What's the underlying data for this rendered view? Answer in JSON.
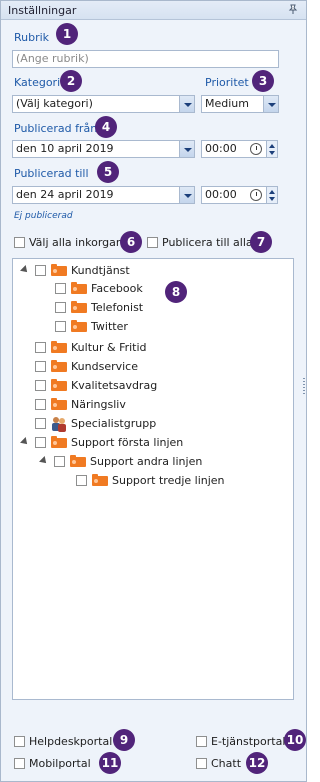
{
  "panel": {
    "title": "Inställningar"
  },
  "rubrik": {
    "label": "Rubrik",
    "placeholder": "(Ange rubrik)",
    "badge": "1"
  },
  "kategori": {
    "label": "Kategori",
    "value": "(Välj kategori)",
    "badge": "2"
  },
  "prioritet": {
    "label": "Prioritet",
    "value": "Medium",
    "badge": "3"
  },
  "publicerad_fran": {
    "label": "Publicerad från",
    "date": "den 10 april 2019",
    "time": "00:00",
    "badge": "4"
  },
  "publicerad_till": {
    "label": "Publicerad till",
    "date": "den 24 april 2019",
    "time": "00:00",
    "badge": "5"
  },
  "status_hint": "Ej publicerad",
  "select_all_inboxes": {
    "label": "Välj alla inkorgar",
    "badge": "6"
  },
  "publish_to_all": {
    "label": "Publicera till alla",
    "badge": "7"
  },
  "tree": {
    "badge": "8",
    "items": [
      {
        "label": "Kundtjänst",
        "icon": "folder-icon",
        "expanded": true
      },
      {
        "label": "Facebook",
        "icon": "folder-icon"
      },
      {
        "label": "Telefonist",
        "icon": "folder-icon"
      },
      {
        "label": "Twitter",
        "icon": "folder-icon"
      },
      {
        "label": "Kultur & Fritid",
        "icon": "folder-icon"
      },
      {
        "label": "Kundservice",
        "icon": "folder-icon"
      },
      {
        "label": "Kvalitetsavdrag",
        "icon": "folder-icon"
      },
      {
        "label": "Näringsliv",
        "icon": "folder-icon"
      },
      {
        "label": "Specialistgrupp",
        "icon": "people-icon"
      },
      {
        "label": "Support första linjen",
        "icon": "folder-icon",
        "expanded": true
      },
      {
        "label": "Support andra linjen",
        "icon": "folder-icon",
        "expanded": true
      },
      {
        "label": "Support tredje linjen",
        "icon": "folder-icon"
      }
    ]
  },
  "portals": {
    "helpdesk": {
      "label": "Helpdeskportal",
      "badge": "9"
    },
    "etjanst": {
      "label": "E-tjänstportal",
      "badge": "10"
    },
    "mobil": {
      "label": "Mobilportal",
      "badge": "11"
    },
    "chatt": {
      "label": "Chatt",
      "badge": "12"
    }
  },
  "colors": {
    "accent": "#1f5aa8",
    "badge": "#51247a",
    "folder": "#f07a22",
    "panel_bg": "#eef3fa"
  }
}
